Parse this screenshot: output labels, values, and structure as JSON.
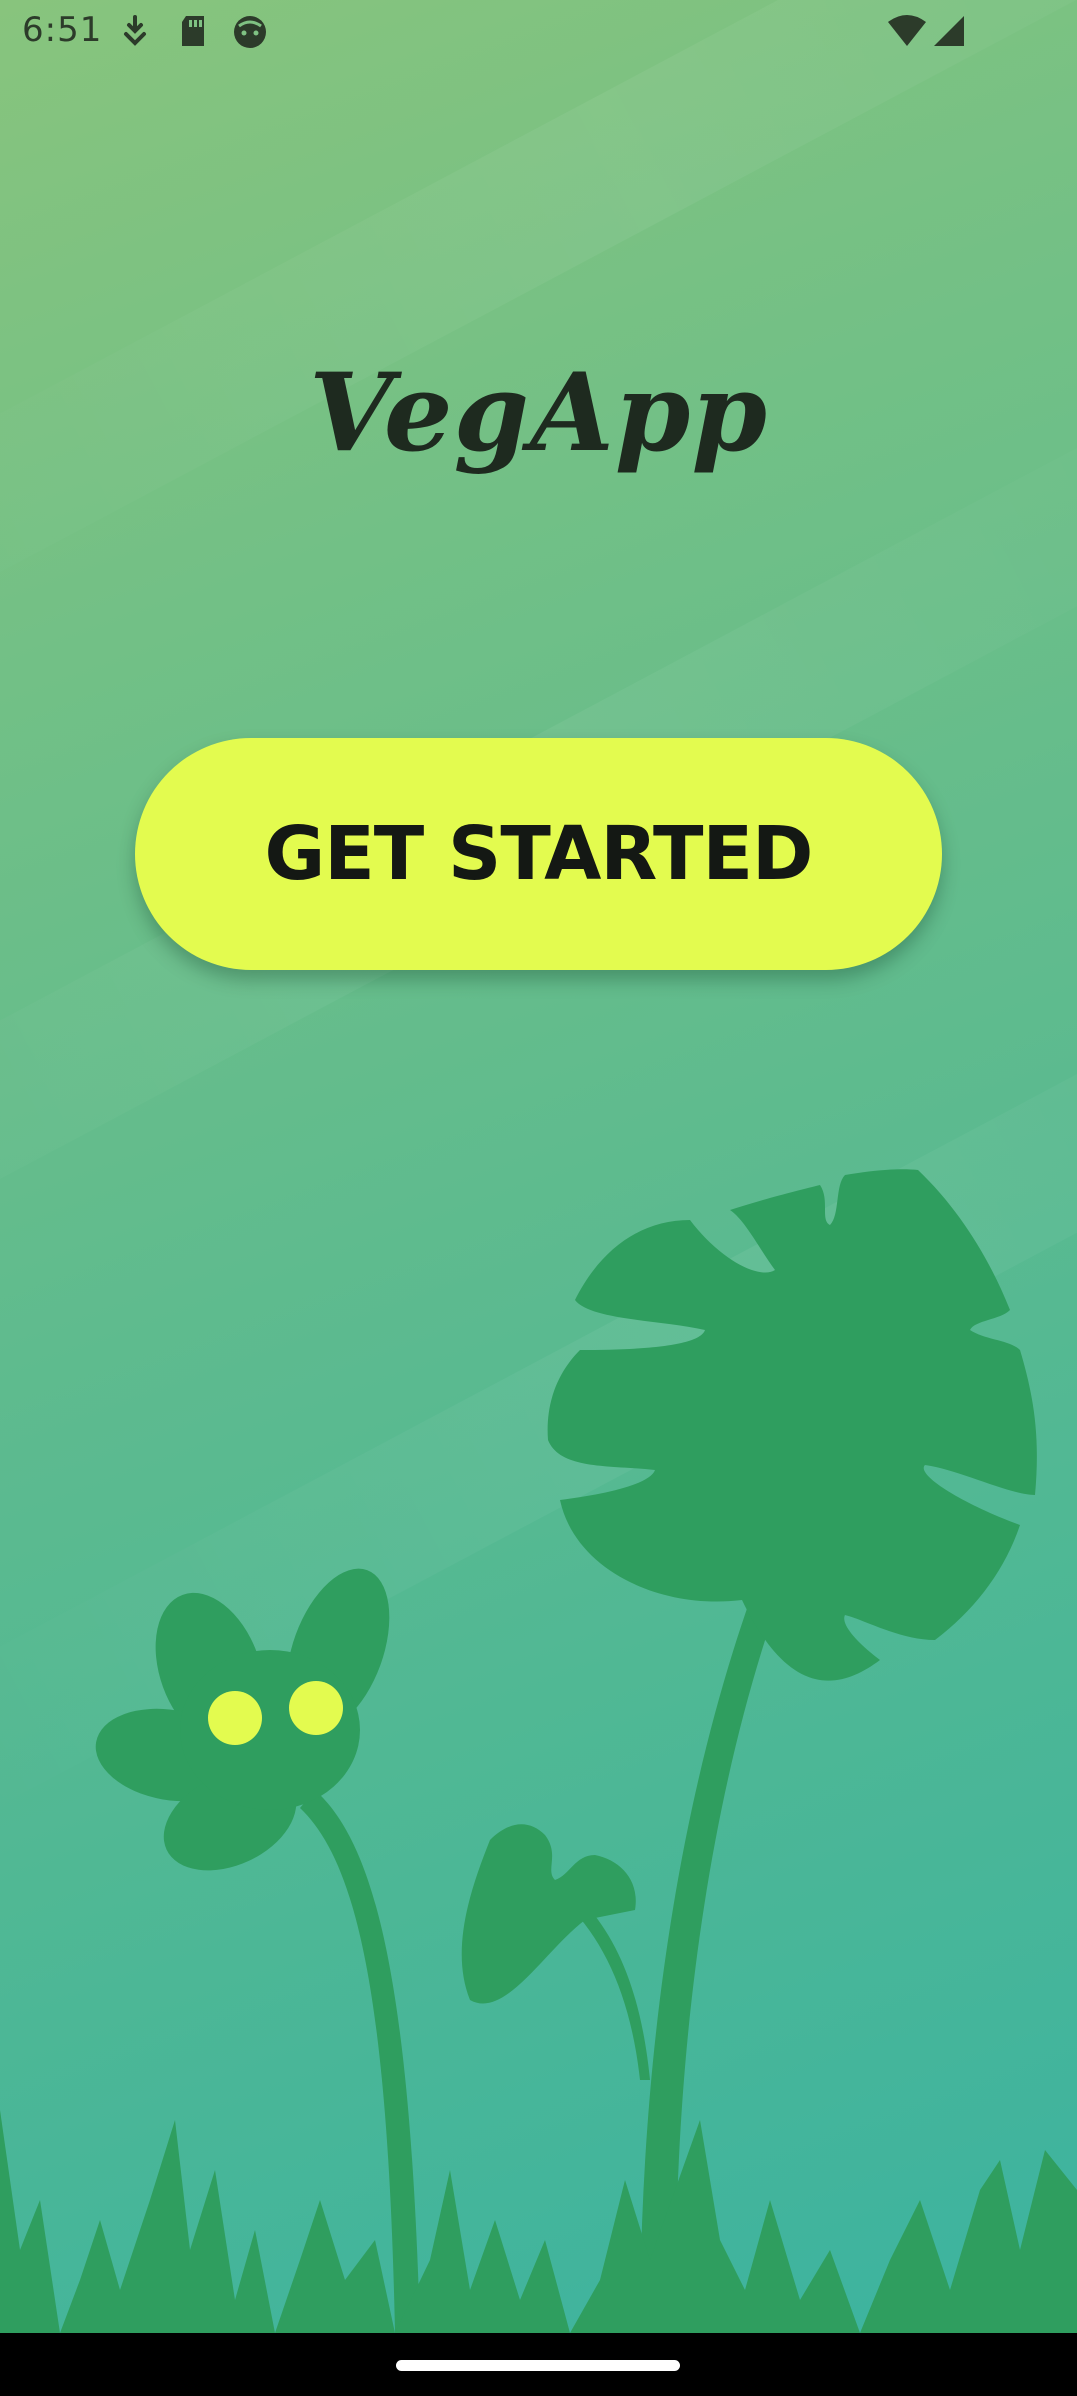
{
  "status_bar": {
    "time": "6:51",
    "left_icons": [
      "download-icon",
      "sd-card-icon",
      "face-icon"
    ],
    "right_icons": [
      "wifi-icon",
      "signal-icon"
    ]
  },
  "app": {
    "title": "VegApp",
    "cta_label": "GET STARTED"
  },
  "colors": {
    "background_top": "#88c47d",
    "background_bottom": "#3cb3a0",
    "button": "#e3fb4f",
    "foliage": "#2f9e5f",
    "flower_eyes": "#e3fb4f",
    "title_text": "#1e2a1f"
  },
  "navigation": {
    "home_indicator": "home-indicator"
  }
}
